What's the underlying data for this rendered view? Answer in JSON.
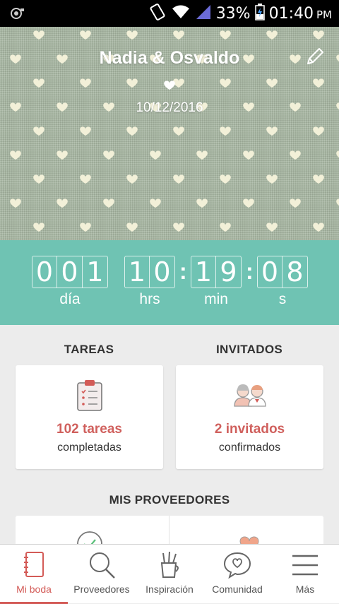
{
  "status_bar": {
    "battery": "33%",
    "time": "01:40",
    "ampm": "PM"
  },
  "hero": {
    "couple_name": "Nadia & Osvaldo",
    "date": "10/12/2016"
  },
  "countdown": {
    "days": [
      "0",
      "0",
      "1"
    ],
    "hours": [
      "1",
      "0"
    ],
    "minutes": [
      "1",
      "9"
    ],
    "seconds": [
      "0",
      "8"
    ],
    "colon": ":",
    "labels": {
      "days": "día",
      "hours": "hrs",
      "minutes": "min",
      "seconds": "s"
    }
  },
  "tasks": {
    "heading": "TAREAS",
    "count": "102 tareas",
    "sub": "completadas"
  },
  "guests": {
    "heading": "INVITADOS",
    "count": "2 invitados",
    "sub": "confirmados"
  },
  "vendors": {
    "heading": "MIS PROVEEDORES"
  },
  "nav": {
    "items": [
      {
        "label": "Mi boda",
        "icon": "notebook-icon"
      },
      {
        "label": "Proveedores",
        "icon": "search-icon"
      },
      {
        "label": "Inspiración",
        "icon": "brushes-cup-icon"
      },
      {
        "label": "Comunidad",
        "icon": "chat-heart-icon"
      },
      {
        "label": "Más",
        "icon": "menu-icon"
      }
    ],
    "active_index": 0
  },
  "colors": {
    "accent": "#d35b57",
    "teal": "#6fc3b3",
    "hero_green": "#a5b4a0"
  }
}
